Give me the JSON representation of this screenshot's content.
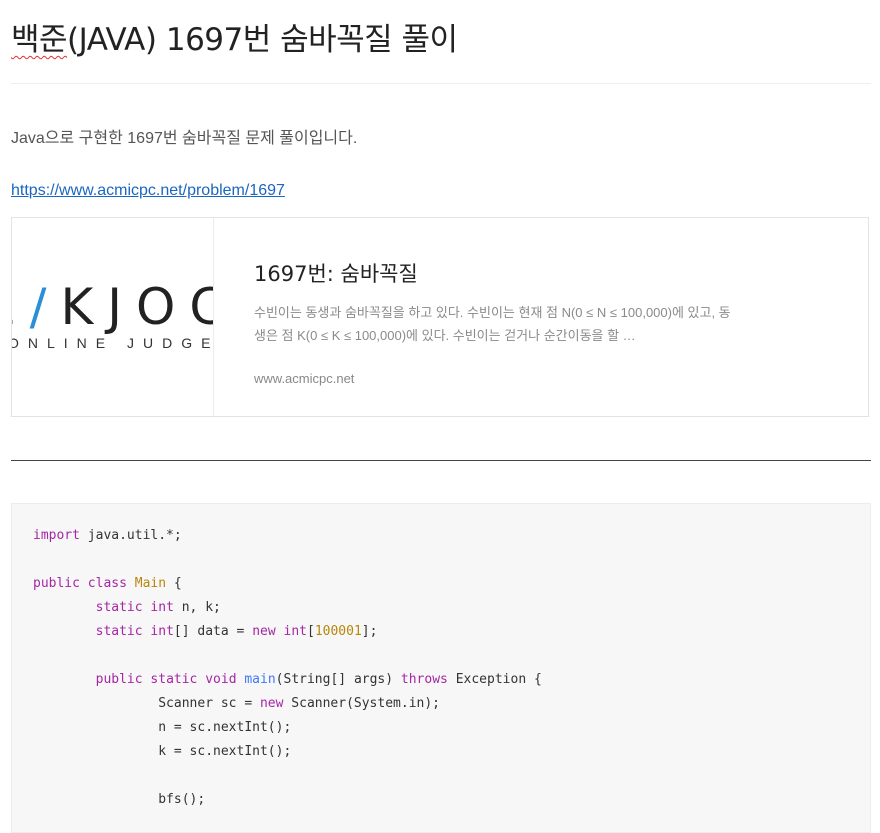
{
  "title": {
    "squiggle_part": "백준",
    "rest": "(JAVA) 1697번 숨바꼭질 풀이"
  },
  "intro": "Java으로 구현한 1697번 숨바꼭질 문제 풀이입니다.",
  "link": "https://www.acmicpc.net/problem/1697",
  "card": {
    "logo_prefix": "E",
    "logo_slash": "/",
    "logo_suffix": "KJOC",
    "logo_sub": "ONLINE JUDGE",
    "title": "1697번: 숨바꼭질",
    "description": "수빈이는 동생과 숨바꼭질을 하고 있다. 수빈이는 현재 점 N(0 ≤ N ≤ 100,000)에 있고, 동생은 점 K(0 ≤ K ≤ 100,000)에 있다. 수빈이는 걷거나 순간이동을 할 …",
    "domain": "www.acmicpc.net"
  },
  "code": {
    "line1": "import java.util.*;",
    "line2": "public class Main {",
    "line3": "static int n, k;",
    "line4": "static int[] data = new int[100001];",
    "line5": "public static void main(String[] args) throws Exception {",
    "line6": "Scanner sc = new Scanner(System.in);",
    "line7": "n = sc.nextInt();",
    "line8": "k = sc.nextInt();",
    "line9": "bfs();"
  },
  "colors": {
    "link": "#1a66c2",
    "keyword": "#a626a4",
    "class": "#b8860b",
    "function": "#4078f2"
  }
}
